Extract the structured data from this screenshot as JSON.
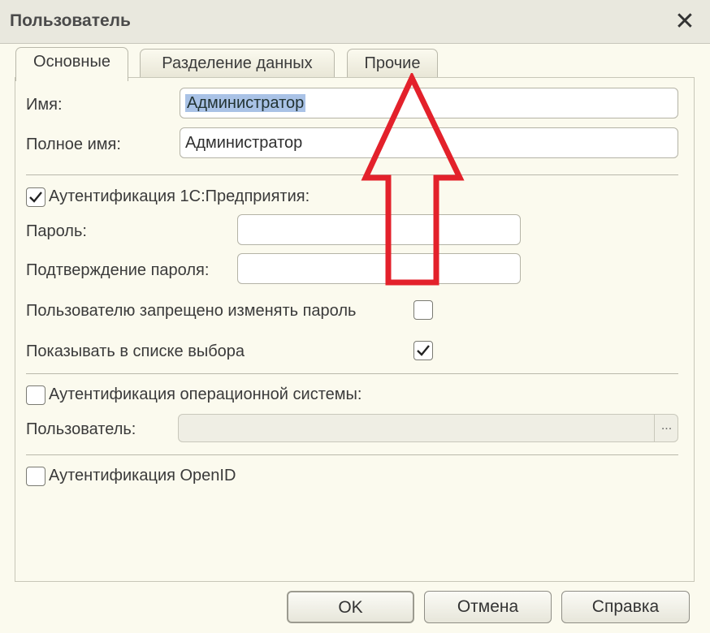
{
  "window": {
    "title": "Пользователь",
    "close_glyph": "✕"
  },
  "tabs": [
    {
      "label": "Основные",
      "active": true
    },
    {
      "label": "Разделение данных",
      "active": false
    },
    {
      "label": "Прочие",
      "active": false
    }
  ],
  "fields": {
    "name_label": "Имя:",
    "name_value": "Администратор",
    "fullname_label": "Полное имя:",
    "fullname_value": "Администратор"
  },
  "auth_1c": {
    "label": "Аутентификация 1С:Предприятия:",
    "checked": true,
    "password_label": "Пароль:",
    "password_value": "",
    "confirm_label": "Подтверждение пароля:",
    "confirm_value": "",
    "forbid_change_label": "Пользователю запрещено изменять пароль",
    "forbid_change_checked": false,
    "show_in_list_label": "Показывать в списке выбора",
    "show_in_list_checked": true
  },
  "auth_os": {
    "label": "Аутентификация операционной системы:",
    "checked": false,
    "user_label": "Пользователь:",
    "user_value": "",
    "browse_label": "..."
  },
  "auth_openid": {
    "label": "Аутентификация OpenID",
    "checked": false
  },
  "buttons": {
    "ok": "OK",
    "cancel": "Отмена",
    "help": "Справка"
  },
  "colors": {
    "annotation_arrow": "#e3212b",
    "background": "#fbfaee",
    "selection": "#a9c2e6"
  }
}
